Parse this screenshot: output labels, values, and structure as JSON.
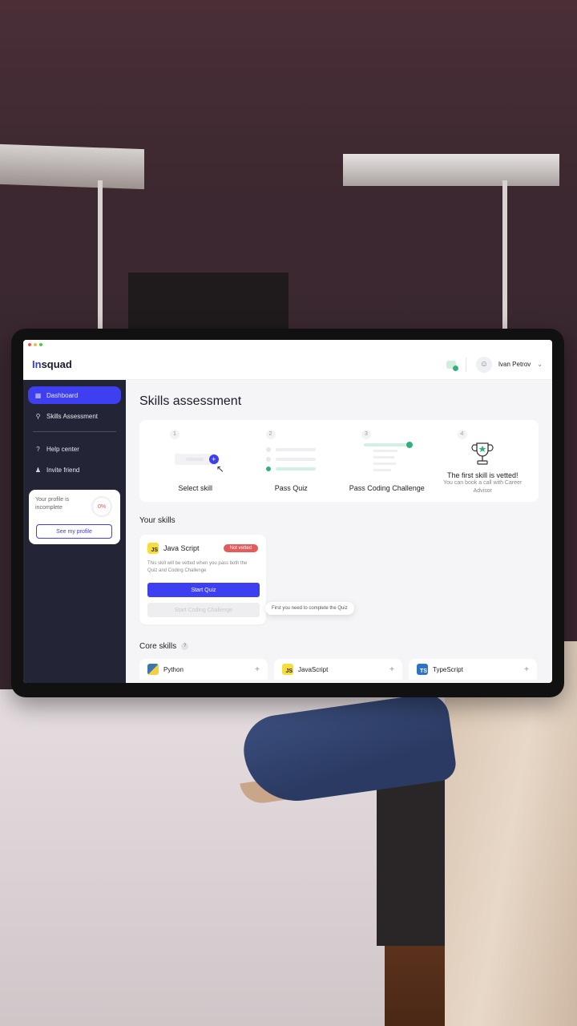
{
  "app": {
    "logo_prefix": "In",
    "logo_suffix": "squad"
  },
  "header": {
    "user_name": "Ivan Petrov"
  },
  "sidebar": {
    "items": [
      {
        "label": "Dashboard",
        "active": true,
        "icon": "grid-icon"
      },
      {
        "label": "Skills Assessment",
        "active": false,
        "icon": "award-icon"
      },
      {
        "label": "Help center",
        "active": false,
        "icon": "help-circle-icon"
      },
      {
        "label": "Invite friend",
        "active": false,
        "icon": "users-icon"
      }
    ],
    "profile": {
      "text": "Your profile is incomplete",
      "percent": "0%",
      "button": "See my profile"
    }
  },
  "main": {
    "title": "Skills assessment",
    "steps": [
      {
        "num": "1",
        "label": "Select skill"
      },
      {
        "num": "2",
        "label": "Pass Quiz"
      },
      {
        "num": "3",
        "label": "Pass Coding Challenge"
      },
      {
        "num": "4",
        "label": "The first skill is vetted!",
        "sub": "You can book a call with Career Advisor"
      }
    ],
    "your_skills_title": "Your skills",
    "skill": {
      "name": "Java Script",
      "icon_text": "JS",
      "badge": "Not vetted",
      "desc": "This skill will be vetted when you pass both the Quiz and Coding Challenge",
      "start_quiz": "Start Quiz",
      "start_challenge": "Start Coding Challenge",
      "tooltip": "First you need to complete the Quiz"
    },
    "core_skills_title": "Core skills",
    "core_skills": [
      {
        "name": "Python",
        "icon": "python-icon"
      },
      {
        "name": "JavaScript",
        "icon": "javascript-icon",
        "icon_text": "JS"
      },
      {
        "name": "TypeScript",
        "icon": "typescript-icon",
        "icon_text": "TS"
      }
    ]
  },
  "colors": {
    "accent": "#3d3ff0",
    "sidebar": "#232536",
    "danger": "#e35b5b",
    "success": "#32b27a"
  }
}
